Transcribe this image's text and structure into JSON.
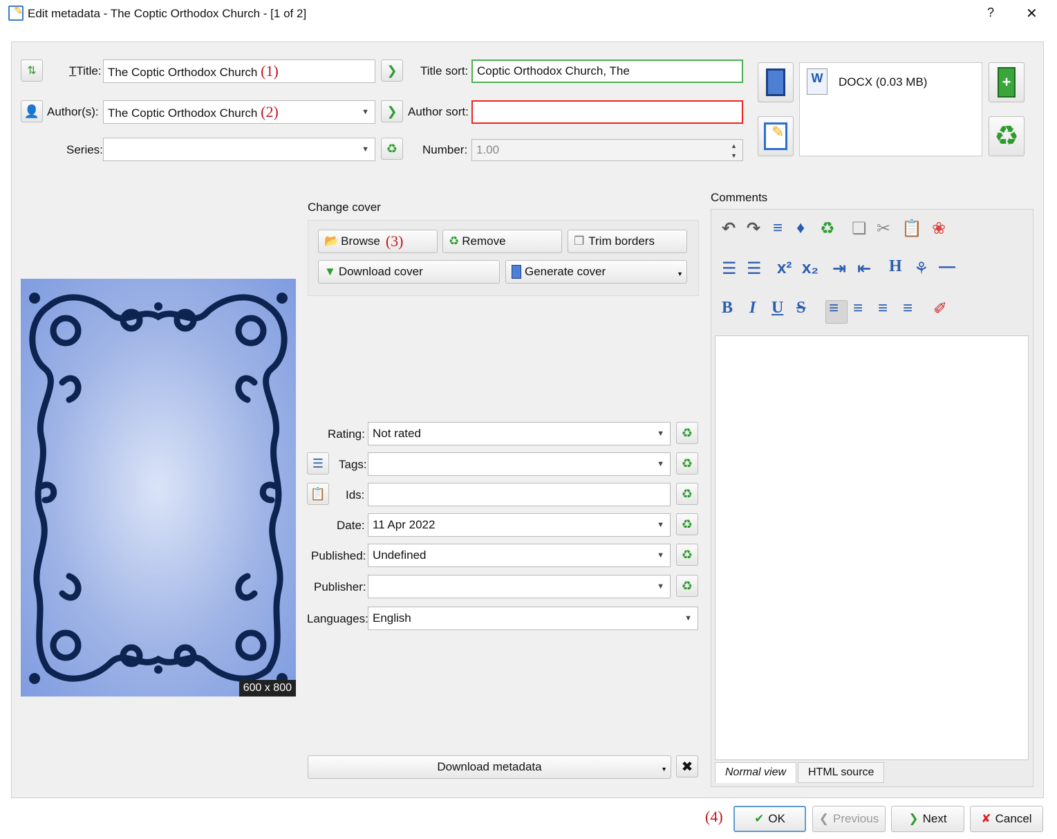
{
  "window": {
    "title": "Edit metadata - The Coptic Orthodox Church -  [1 of 2]",
    "help": "?",
    "close": "✕"
  },
  "fields": {
    "title_label": "Title:",
    "title_value": "The Coptic Orthodox Church",
    "title_sort_label": "Title sort:",
    "title_sort_value": "Coptic Orthodox Church, The",
    "authors_label": "Author(s):",
    "authors_value": "The Coptic Orthodox Church",
    "author_sort_label": "Author sort:",
    "author_sort_value": "",
    "series_label": "Series:",
    "series_value": "",
    "number_label": "Number:",
    "number_value": "1.00"
  },
  "annotations": {
    "a1": "(1)",
    "a2": "(2)",
    "a3": "(3)",
    "a4": "(4)"
  },
  "formats": {
    "item": "DOCX (0.03 MB)"
  },
  "cover": {
    "heading": "Change cover",
    "browse": "Browse",
    "remove": "Remove",
    "trim": "Trim borders",
    "download": "Download cover",
    "generate": "Generate cover",
    "size": "600 x 800"
  },
  "meta": {
    "rating_label": "Rating:",
    "rating_value": "Not rated",
    "tags_label": "Tags:",
    "tags_value": "",
    "ids_label": "Ids:",
    "ids_value": "",
    "date_label": "Date:",
    "date_value": "11 Apr 2022",
    "published_label": "Published:",
    "published_value": "Undefined",
    "publisher_label": "Publisher:",
    "publisher_value": "",
    "languages_label": "Languages:",
    "languages_value": "English",
    "download_metadata": "Download metadata"
  },
  "comments": {
    "heading": "Comments",
    "tab_normal": "Normal view",
    "tab_html": "HTML source"
  },
  "buttons": {
    "ok": "OK",
    "previous": "Previous",
    "next": "Next",
    "cancel": "Cancel"
  },
  "colors": {
    "recycle": "#2e9b2e",
    "annotation": "#c0141c",
    "accent_blue": "#2a5db0"
  }
}
